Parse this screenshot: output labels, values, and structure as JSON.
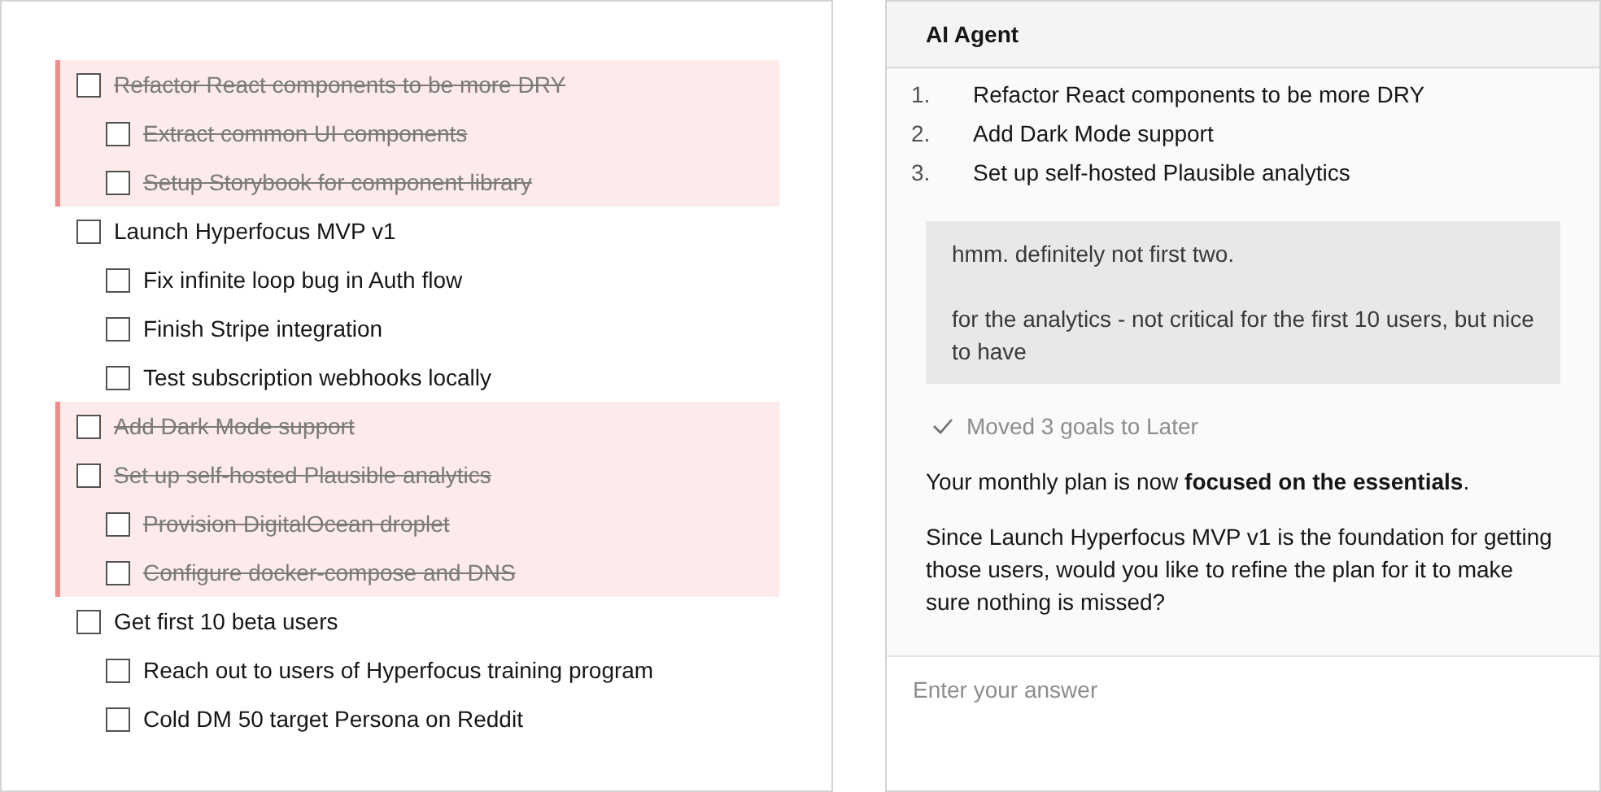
{
  "goals": [
    {
      "label": "Refactor React components to be more DRY",
      "checked": false,
      "removed": true,
      "children": [
        {
          "label": "Extract common UI components",
          "checked": false,
          "removed": true
        },
        {
          "label": "Setup Storybook for component library",
          "checked": false,
          "removed": true
        }
      ]
    },
    {
      "label": "Launch Hyperfocus MVP v1",
      "checked": false,
      "removed": false,
      "children": [
        {
          "label": "Fix infinite loop bug in Auth flow",
          "checked": false,
          "removed": false
        },
        {
          "label": "Finish Stripe integration",
          "checked": false,
          "removed": false
        },
        {
          "label": "Test subscription webhooks locally",
          "checked": false,
          "removed": false
        }
      ]
    },
    {
      "label": "Add Dark Mode support",
      "checked": false,
      "removed": true
    },
    {
      "label": "Set up self-hosted Plausible analytics",
      "checked": false,
      "removed": true,
      "children": [
        {
          "label": "Provision DigitalOcean droplet",
          "checked": false,
          "removed": true
        },
        {
          "label": "Configure docker-compose and DNS",
          "checked": false,
          "removed": true
        }
      ]
    },
    {
      "label": "Get first 10 beta users",
      "checked": false,
      "removed": false,
      "children": [
        {
          "label": "Reach out to users of Hyperfocus training program",
          "checked": false,
          "removed": false
        },
        {
          "label": "Cold DM 50 target Persona on Reddit",
          "checked": false,
          "removed": false
        }
      ]
    }
  ],
  "chat": {
    "title": "AI Agent",
    "messages": [
      {
        "kind": "list",
        "items": [
          {
            "number": "1.",
            "text": "Refactor React components to be more DRY"
          },
          {
            "number": "2.",
            "text": "Add Dark Mode support"
          },
          {
            "number": "3.",
            "text": "Set up self-hosted Plausible analytics"
          }
        ]
      },
      {
        "kind": "user",
        "paragraphs": [
          "hmm. definitely not first two.",
          "for the analytics - not critical for the first 10 users, but nice to have"
        ]
      },
      {
        "kind": "status",
        "text": "Moved 3 goals to Later"
      },
      {
        "kind": "text",
        "text": "Your monthly plan is now **focused on the essentials**."
      },
      {
        "kind": "text",
        "text": "Since Launch Hyperfocus MVP v1 is the foundation for getting those users, would you like to refine the plan for it to make sure nothing is missed?"
      }
    ],
    "input": {
      "placeholder": "Enter your answer"
    }
  }
}
